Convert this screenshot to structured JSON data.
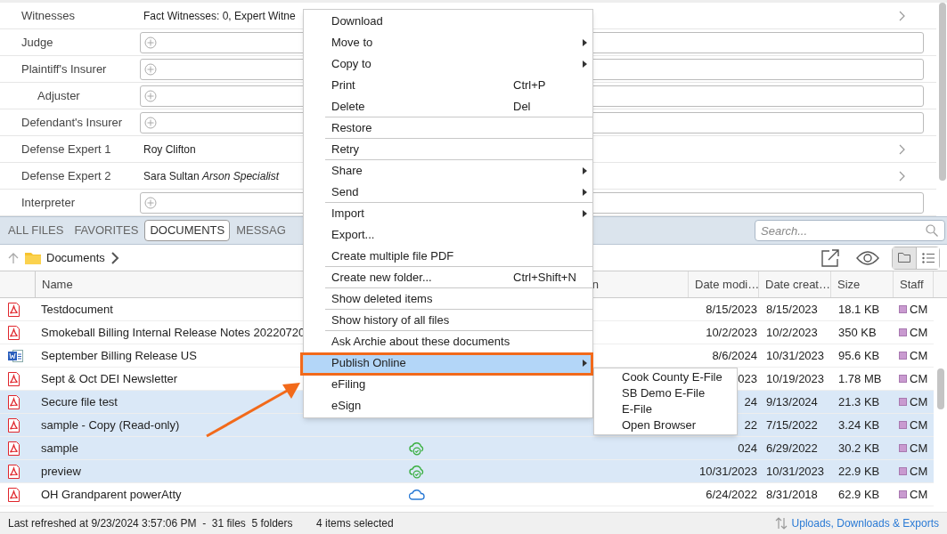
{
  "details": [
    {
      "kind": "link",
      "label": "Witnesses",
      "value": "Fact Witnesses: 0, Expert Witne"
    },
    {
      "kind": "field",
      "label": "Judge"
    },
    {
      "kind": "field",
      "label": "Plaintiff's Insurer",
      "children": [
        {
          "kind": "field",
          "label": "Adjuster"
        }
      ]
    },
    {
      "kind": "field",
      "label": "Defendant's Insurer"
    },
    {
      "kind": "link",
      "label": "Defense Expert 1",
      "value": "Roy Clifton"
    },
    {
      "kind": "link",
      "label": "Defense Expert 2",
      "value": "Sara Sultan *Arson Specialist*"
    },
    {
      "kind": "field",
      "label": "Interpreter"
    }
  ],
  "tabs": [
    {
      "label": "ALL FILES",
      "selected": false
    },
    {
      "label": "FAVORITES",
      "selected": false
    },
    {
      "label": "DOCUMENTS",
      "selected": true
    },
    {
      "label": "MESSAG",
      "selected": false
    }
  ],
  "search": {
    "placeholder": "Search..."
  },
  "breadcrumb": [
    "Documents"
  ],
  "views": [
    {
      "kind": "folders",
      "selected": true
    },
    {
      "kind": "list",
      "selected": false
    }
  ],
  "table": {
    "columns": [
      "Name",
      "n",
      "Date modi…",
      "Date creat…",
      "Size",
      "Staff"
    ],
    "rows": [
      {
        "kind": "pdf",
        "name": "Testdocument",
        "date_modified": "8/15/2023",
        "date_created": "8/15/2023",
        "size": "18.1 KB",
        "staff": "CM",
        "selected": false
      },
      {
        "kind": "pdf",
        "name": "Smokeball Billing Internal Release Notes 20220720",
        "date_modified": "10/2/2023",
        "date_created": "10/2/2023",
        "size": "350 KB",
        "staff": "CM",
        "selected": false
      },
      {
        "kind": "word",
        "name": "September Billing Release US",
        "date_modified": "8/6/2024",
        "date_created": "10/31/2023",
        "size": "95.6 KB",
        "staff": "CM",
        "selected": false
      },
      {
        "kind": "pdf",
        "name": "Sept & Oct DEI Newsletter",
        "date_modified": "023",
        "date_created": "10/19/2023",
        "size": "1.78 MB",
        "staff": "CM",
        "selected": false
      },
      {
        "kind": "pdf",
        "name": "Secure file test",
        "date_modified": "24",
        "date_created": "9/13/2024",
        "size": "21.3 KB",
        "staff": "CM",
        "selected": true
      },
      {
        "kind": "pdf",
        "name": "sample - Copy (Read-only)",
        "date_modified": "22",
        "date_created": "7/15/2022",
        "size": "3.24 KB",
        "staff": "CM",
        "selected": true
      },
      {
        "kind": "pdf",
        "name": "sample",
        "synced": true,
        "date_modified": "024",
        "date_created": "6/29/2022",
        "size": "30.2 KB",
        "staff": "CM",
        "selected": true
      },
      {
        "kind": "pdf",
        "name": "preview",
        "synced": true,
        "date_modified": "10/31/2023",
        "date_created": "10/31/2023",
        "size": "22.9 KB",
        "staff": "CM",
        "selected": true
      },
      {
        "kind": "pdf",
        "name": "OH Grandparent powerAtty",
        "synced": false,
        "date_modified": "6/24/2022",
        "date_created": "8/31/2018",
        "size": "62.9 KB",
        "staff": "CM",
        "selected": false
      }
    ]
  },
  "status_bar": {
    "refreshed": "Last refreshed at 9/23/2024 3:57:06 PM  -  31 files  5 folders",
    "selection": "4 items selected",
    "link": "Uploads, Downloads & Exports"
  },
  "context_menu": [
    {
      "label": "Download",
      "submenu": false,
      "separator": false,
      "selected": false
    },
    {
      "label": "Move to",
      "submenu": true,
      "separator": false,
      "selected": false
    },
    {
      "label": "Copy to",
      "submenu": true,
      "separator": false,
      "selected": false
    },
    {
      "label": "Print",
      "shortcut": "Ctrl+P",
      "submenu": false,
      "separator": false,
      "selected": false
    },
    {
      "label": "Delete",
      "shortcut": "Del",
      "submenu": false,
      "separator": true,
      "selected": false
    },
    {
      "label": "Restore",
      "submenu": false,
      "separator": true,
      "selected": false
    },
    {
      "label": "Retry",
      "submenu": false,
      "separator": true,
      "selected": false
    },
    {
      "label": "Share",
      "submenu": true,
      "separator": false,
      "selected": false
    },
    {
      "label": "Send",
      "submenu": true,
      "separator": true,
      "selected": false
    },
    {
      "label": "Import",
      "submenu": true,
      "separator": false,
      "selected": false
    },
    {
      "label": "Export...",
      "submenu": false,
      "separator": false,
      "selected": false
    },
    {
      "label": "Create multiple file PDF",
      "submenu": false,
      "separator": true,
      "selected": false
    },
    {
      "label": "Create new folder...",
      "shortcut": "Ctrl+Shift+N",
      "submenu": false,
      "separator": true,
      "selected": false
    },
    {
      "label": "Show deleted items",
      "submenu": false,
      "separator": true,
      "selected": false
    },
    {
      "label": "Show history of all files",
      "submenu": false,
      "separator": true,
      "selected": false
    },
    {
      "label": "Ask Archie about these documents",
      "submenu": false,
      "separator": false,
      "selected": false
    },
    {
      "label": "Publish Online",
      "submenu": true,
      "separator": false,
      "selected": true,
      "highlighted": true
    },
    {
      "label": "eFiling",
      "submenu": false,
      "separator": false,
      "selected": false
    },
    {
      "label": "eSign",
      "submenu": false,
      "separator": false,
      "selected": false
    }
  ],
  "submenu": [
    "Cook County E-File",
    "SB Demo E-File",
    "E-File",
    "Open Browser"
  ]
}
